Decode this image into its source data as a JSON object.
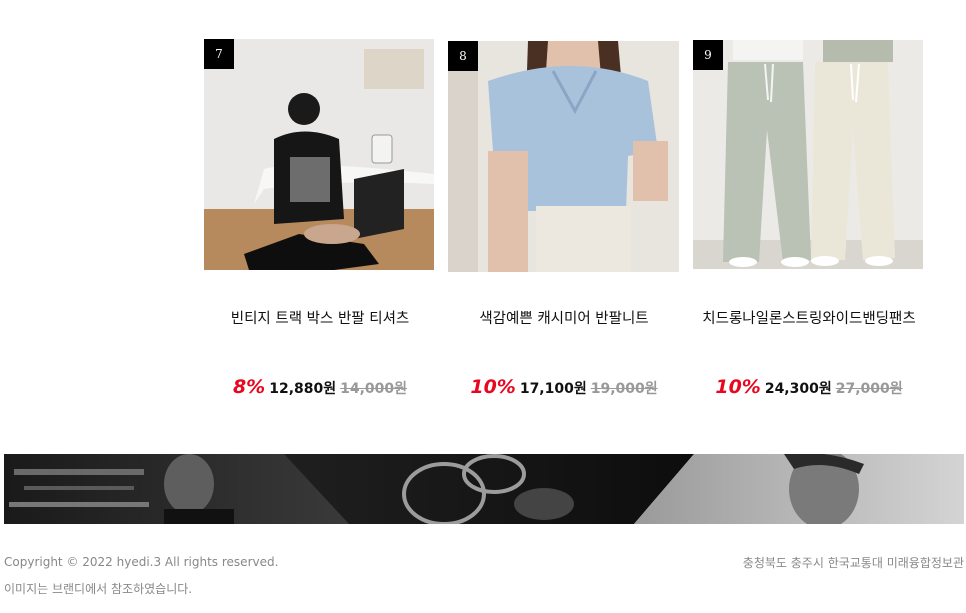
{
  "products": [
    {
      "rank": "7",
      "name": "빈티지 트랙 박스 반팔 티셔츠",
      "discount": "8%",
      "sale_price": "12,880원",
      "original_price": "14,000원",
      "image": "woman-black-tee-photo"
    },
    {
      "rank": "8",
      "name": "색감예쁜 캐시미어 반팔니트",
      "discount": "10%",
      "sale_price": "17,100원",
      "original_price": "19,000원",
      "image": "blue-knit-photo"
    },
    {
      "rank": "9",
      "name": "치드롱나일론스트링와이드밴딩팬츠",
      "discount": "10%",
      "sale_price": "24,300원",
      "original_price": "27,000원",
      "image": "wide-pants-photo"
    }
  ],
  "banner": {
    "image": "monochrome-model-banner"
  },
  "footer": {
    "copyright": "Copyright © 2022 hyedi.3 All rights reserved.",
    "notice": "이미지는 브랜디에서 참조하였습니다.",
    "address": "충청북도 충주시 한국교통대 미래융합정보관"
  },
  "colors": {
    "discount": "#e8071f",
    "rank_badge": "#000000",
    "original_price": "#999999"
  }
}
